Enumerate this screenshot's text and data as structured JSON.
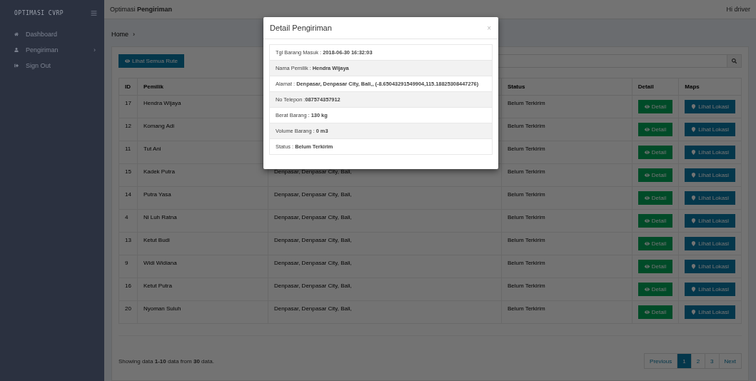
{
  "sidebar": {
    "brand": "OPTIMASI CVRP",
    "items": [
      {
        "label": "Dashboard"
      },
      {
        "label": "Pengiriman",
        "chevron": "›"
      },
      {
        "label": "Sign Out"
      }
    ]
  },
  "header": {
    "title_prefix": "Optimasi",
    "title_bold": "Pengiriman",
    "user": "Hi driver"
  },
  "breadcrumb": [
    {
      "label": "Home",
      "separator": "›"
    }
  ],
  "toolbar": {
    "button": "Lihat Semua Rute"
  },
  "table": {
    "columns": [
      {
        "label": "ID"
      },
      {
        "label": "Pemilik"
      },
      {},
      {
        "label": "Status"
      },
      {
        "label": "Detail"
      },
      {
        "label": "Maps"
      }
    ],
    "rows": [
      {
        "id": "17",
        "owner": "Hendra Wijaya",
        "status": "Belum Terkirim",
        "detail": "Detail",
        "maps": "Lihat Lokasi"
      },
      {
        "id": "12",
        "owner": "Komang Adi",
        "status": "Belum Terkirim",
        "detail": "Detail",
        "maps": "Lihat Lokasi"
      },
      {
        "id": "11",
        "owner": "Tut Ani",
        "status": "Belum Terkirim",
        "detail": "Detail",
        "maps": "Lihat Lokasi"
      },
      {
        "id": "15",
        "owner": "Kadek Putra",
        "address": "Denpasar, Denpasar City, Bali,",
        "status": "Belum Terkirim",
        "detail": "Detail",
        "maps": "Lihat Lokasi"
      },
      {
        "id": "14",
        "owner": "Putra Yasa",
        "address": "Denpasar, Denpasar City, Bali,",
        "status": "Belum Terkirim",
        "detail": "Detail",
        "maps": "Lihat Lokasi"
      },
      {
        "id": "4",
        "owner": "Ni Luh Ratna",
        "address": "Denpasar, Denpasar City, Bali,",
        "status": "Belum Terkirim",
        "detail": "Detail",
        "maps": "Lihat Lokasi"
      },
      {
        "id": "13",
        "owner": "Ketut Budi",
        "address": "Denpasar, Denpasar City, Bali,",
        "status": "Belum Terkirim",
        "detail": "Detail",
        "maps": "Lihat Lokasi"
      },
      {
        "id": "9",
        "owner": "Widi Widiana",
        "address": "Denpasar, Denpasar City, Bali,",
        "status": "Belum Terkirim",
        "detail": "Detail",
        "maps": "Lihat Lokasi"
      },
      {
        "id": "16",
        "owner": "Ketut Putra",
        "address": "Denpasar, Denpasar City, Bali,",
        "status": "Belum Terkirim",
        "detail": "Detail",
        "maps": "Lihat Lokasi"
      },
      {
        "id": "20",
        "owner": "Nyoman Suluh",
        "address": "Denpasar, Denpasar City, Bali,",
        "status": "Belum Terkirim",
        "detail": "Detail",
        "maps": "Lihat Lokasi"
      }
    ]
  },
  "footer": {
    "summary": "Showing data **1-10** data from **30** data.",
    "pagination": [
      {
        "label": "Previous",
        "selected": false
      },
      {
        "label": "1",
        "selected": true
      },
      {
        "label": "2",
        "selected": false
      },
      {
        "label": "3",
        "selected": false
      },
      {
        "label": "Next",
        "selected": false
      }
    ]
  },
  "modal": {
    "title": "Detail Pengiriman",
    "close": "×",
    "lines": [
      {
        "label": "Tgl Barang Masuk : ",
        "value": "2018-06-30 16:32:03"
      },
      {
        "label": "Nama Pemilik : ",
        "value": "Hendra Wijaya"
      },
      {
        "label": "Alamat : ",
        "value": "Denpasar, Denpasar City, Bali,, (-8.65043291549904,115.18825308447276)"
      },
      {
        "label": "No Telepon :",
        "value": "087574357912"
      },
      {
        "label": "Berat Barang : ",
        "value": "130 kg"
      },
      {
        "label": "Volume Barang : ",
        "value": "0 m3"
      },
      {
        "label": "Status : ",
        "value": "Belum Terkirim"
      }
    ]
  }
}
